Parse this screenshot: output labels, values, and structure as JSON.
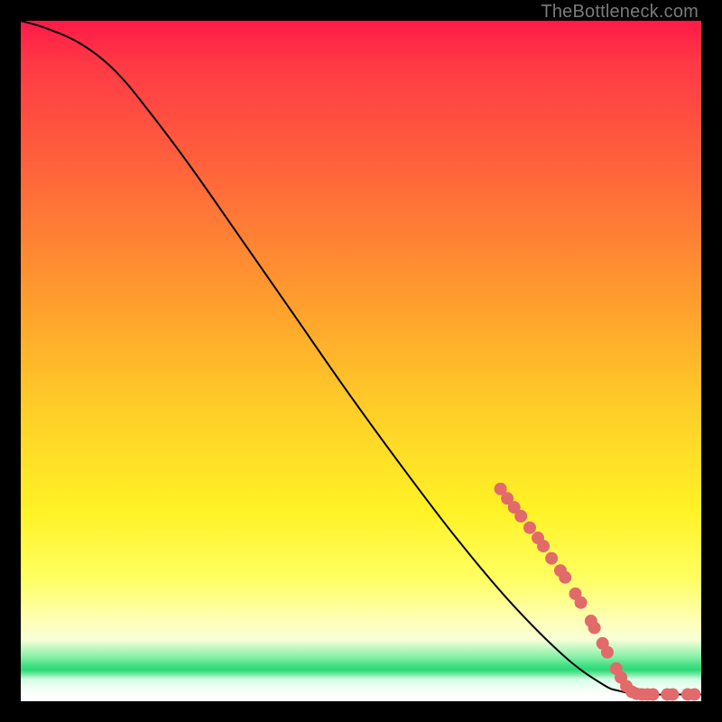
{
  "watermark": "TheBottleneck.com",
  "colors": {
    "background": "#000000",
    "curve_stroke": "#000000",
    "marker_fill": "#e26a6a",
    "marker_stroke": "#c65454"
  },
  "chart_data": {
    "type": "line",
    "title": "",
    "xlabel": "",
    "ylabel": "",
    "xlim": [
      0,
      100
    ],
    "ylim": [
      0,
      100
    ],
    "grid": false,
    "legend": false,
    "series": [
      {
        "name": "curve",
        "note": "Smooth decreasing curve from top-left to bottom-right; values are fractional plot-area coordinates (0,0 = top-left, 1,1 = bottom-right) estimated from gridlines.",
        "points": [
          {
            "x": 0.0,
            "y": 0.0
          },
          {
            "x": 0.04,
            "y": 0.012
          },
          {
            "x": 0.09,
            "y": 0.035
          },
          {
            "x": 0.14,
            "y": 0.075
          },
          {
            "x": 0.19,
            "y": 0.135
          },
          {
            "x": 0.25,
            "y": 0.215
          },
          {
            "x": 0.32,
            "y": 0.315
          },
          {
            "x": 0.4,
            "y": 0.43
          },
          {
            "x": 0.48,
            "y": 0.545
          },
          {
            "x": 0.56,
            "y": 0.655
          },
          {
            "x": 0.64,
            "y": 0.76
          },
          {
            "x": 0.72,
            "y": 0.855
          },
          {
            "x": 0.8,
            "y": 0.935
          },
          {
            "x": 0.855,
            "y": 0.975
          },
          {
            "x": 0.88,
            "y": 0.985
          },
          {
            "x": 0.91,
            "y": 0.99
          },
          {
            "x": 0.95,
            "y": 0.99
          },
          {
            "x": 1.0,
            "y": 0.99
          }
        ]
      }
    ],
    "markers": {
      "name": "highlighted-segment",
      "note": "Thick salmon markers overlaid on the lower-right portion of the curve; fractional plot-area coordinates.",
      "points": [
        {
          "x": 0.705,
          "y": 0.688
        },
        {
          "x": 0.715,
          "y": 0.702
        },
        {
          "x": 0.725,
          "y": 0.715
        },
        {
          "x": 0.735,
          "y": 0.728
        },
        {
          "x": 0.748,
          "y": 0.745
        },
        {
          "x": 0.76,
          "y": 0.76
        },
        {
          "x": 0.768,
          "y": 0.772
        },
        {
          "x": 0.78,
          "y": 0.79
        },
        {
          "x": 0.793,
          "y": 0.808
        },
        {
          "x": 0.8,
          "y": 0.818
        },
        {
          "x": 0.815,
          "y": 0.842
        },
        {
          "x": 0.823,
          "y": 0.855
        },
        {
          "x": 0.838,
          "y": 0.882
        },
        {
          "x": 0.843,
          "y": 0.892
        },
        {
          "x": 0.855,
          "y": 0.915
        },
        {
          "x": 0.862,
          "y": 0.928
        },
        {
          "x": 0.875,
          "y": 0.952
        },
        {
          "x": 0.882,
          "y": 0.965
        },
        {
          "x": 0.89,
          "y": 0.978
        },
        {
          "x": 0.898,
          "y": 0.986
        },
        {
          "x": 0.905,
          "y": 0.989
        },
        {
          "x": 0.913,
          "y": 0.99
        },
        {
          "x": 0.921,
          "y": 0.99
        },
        {
          "x": 0.929,
          "y": 0.99
        },
        {
          "x": 0.95,
          "y": 0.99
        },
        {
          "x": 0.958,
          "y": 0.99
        },
        {
          "x": 0.98,
          "y": 0.99
        },
        {
          "x": 0.99,
          "y": 0.99
        }
      ]
    }
  }
}
